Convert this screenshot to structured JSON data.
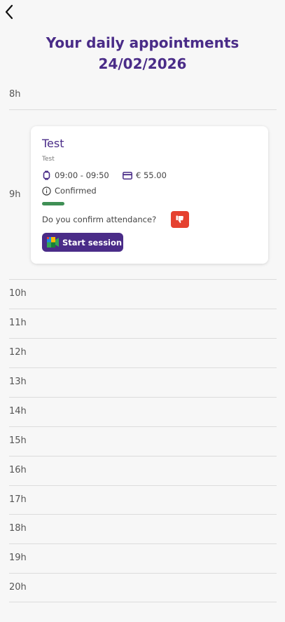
{
  "header": {
    "title_line1": "Your daily appointments",
    "title_line2": "24/02/2026"
  },
  "hours": [
    "8h",
    "9h",
    "10h",
    "11h",
    "12h",
    "13h",
    "14h",
    "15h",
    "16h",
    "17h",
    "18h",
    "19h",
    "20h"
  ],
  "appointment": {
    "title": "Test",
    "subtitle": "Test",
    "time": "09:00 - 09:50",
    "price": "€ 55.00",
    "status": "Confirmed",
    "confirm_question": "Do you confirm attendance?",
    "start_label": "Start session"
  },
  "colors": {
    "brand": "#4a2c88",
    "status_confirmed": "#3f8f55",
    "decline": "#e5412f"
  },
  "icons": [
    "back-arrow-icon",
    "watch-icon",
    "card-icon",
    "info-icon",
    "thumbs-down-icon",
    "google-meet-icon"
  ]
}
